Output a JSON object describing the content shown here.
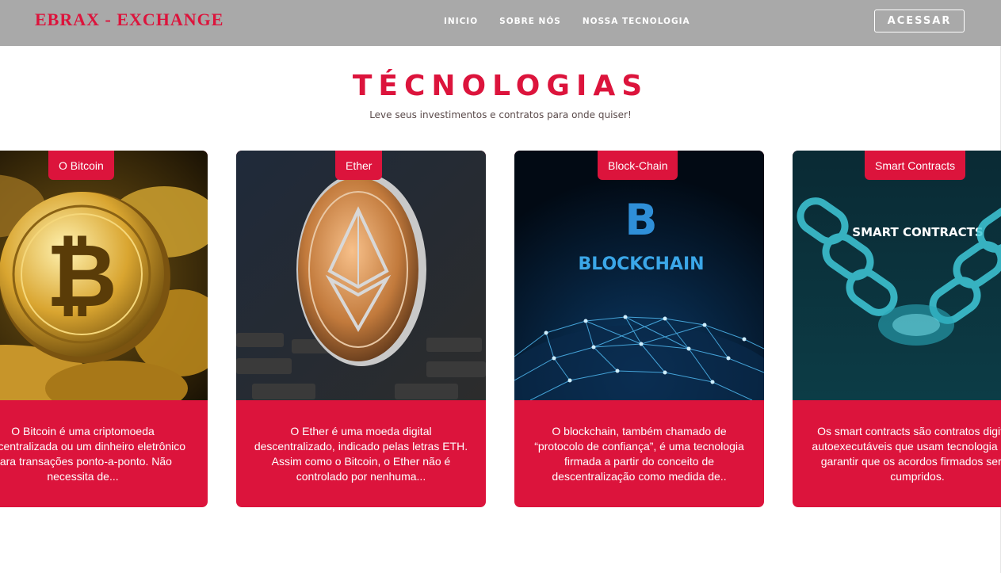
{
  "header": {
    "brand": "EBRAX - EXCHANGE",
    "nav": [
      "INICIO",
      "SOBRE NÓS",
      "NOSSA TECNOLOGIA"
    ],
    "login_label": "ACESSAR"
  },
  "section": {
    "title": "TÉCNOLOGIAS",
    "subtitle": "Leve seus investimentos e contratos para onde quiser!"
  },
  "cards": [
    {
      "tag": "O Bitcoin",
      "image_icon": "bitcoin-coin-image",
      "text": "O Bitcoin é uma criptomoeda descentralizada ou um dinheiro eletrônico para transações ponto-a-ponto. Não necessita de..."
    },
    {
      "tag": "Ether",
      "image_icon": "ether-coin-image",
      "text": "O Ether é uma moeda digital descentralizado, indicado pelas letras ETH. Assim como o Bitcoin, o Ether não é controlado por nenhuma..."
    },
    {
      "tag": "Block-Chain",
      "image_icon": "blockchain-image",
      "image_caption": "BLOCKCHAIN",
      "text": "O blockchain, também chamado de “protocolo de confiança”, é uma tecnologia firmada a partir do conceito de descentralização como medida de.."
    },
    {
      "tag": "Smart Contracts",
      "image_icon": "smart-contracts-image",
      "image_caption": "SMART CONTRACTS",
      "text": "Os smart contracts são contratos digitais autoexecutáveis que usam tecnologia para garantir que os acordos firmados serão cumpridos."
    }
  ],
  "colors": {
    "accent": "#dc143c",
    "navbar": "#a9a9a9",
    "white": "#ffffff"
  }
}
